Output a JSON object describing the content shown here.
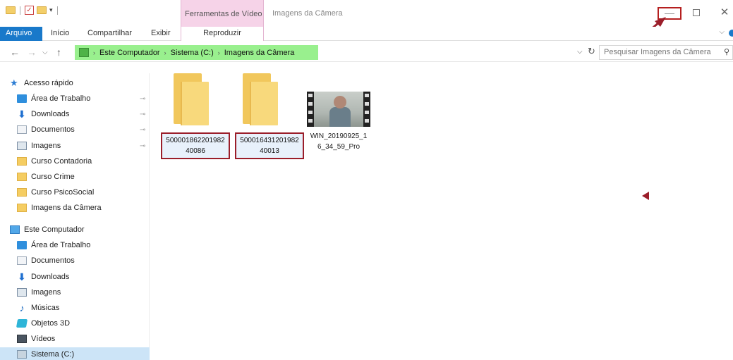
{
  "titlebar": {
    "contextual_tab": "Ferramentas de Vídeo",
    "window_title": "Imagens da Câmera",
    "qat_check": "✓",
    "qat_dropdown": "▾",
    "min_glyph": "",
    "max_glyph": "",
    "close_glyph": "✕"
  },
  "ribbon": {
    "tabs": {
      "file": "Arquivo",
      "inicio": "Início",
      "compartilhar": "Compartilhar",
      "exibir": "Exibir",
      "reproduzir": "Reproduzir"
    },
    "chevron": "⌵"
  },
  "nav": {
    "back": "←",
    "forward": "→",
    "recent": "⌵",
    "up": "↑"
  },
  "address": {
    "sep": "›",
    "crumbs": [
      "Este Computador",
      "Sistema (C:)",
      "Imagens da Câmera"
    ],
    "dropdown": "⌵",
    "refresh": "↻"
  },
  "search": {
    "placeholder": "Pesquisar Imagens da Câmera",
    "icon": "⚲"
  },
  "sidebar": {
    "items": [
      {
        "label": "Acesso rápido",
        "icon": "star-icon",
        "pinned": false
      },
      {
        "label": "Área de Trabalho",
        "icon": "desktop-icon",
        "pinned": true
      },
      {
        "label": "Downloads",
        "icon": "download-icon",
        "pinned": true
      },
      {
        "label": "Documentos",
        "icon": "document-icon",
        "pinned": true
      },
      {
        "label": "Imagens",
        "icon": "pictures-icon",
        "pinned": true
      },
      {
        "label": "Curso Contadoria",
        "icon": "folder-icon",
        "pinned": false
      },
      {
        "label": "Curso Crime",
        "icon": "folder-icon",
        "pinned": false
      },
      {
        "label": "Curso PsicoSocial",
        "icon": "folder-icon",
        "pinned": false
      },
      {
        "label": "Imagens da Câmera",
        "icon": "folder-icon",
        "pinned": false
      },
      {
        "label": "Este Computador",
        "icon": "computer-icon",
        "pinned": false
      },
      {
        "label": "Área de Trabalho",
        "icon": "desktop-icon",
        "pinned": false
      },
      {
        "label": "Documentos",
        "icon": "document-icon",
        "pinned": false
      },
      {
        "label": "Downloads",
        "icon": "download-icon",
        "pinned": false
      },
      {
        "label": "Imagens",
        "icon": "pictures-icon",
        "pinned": false
      },
      {
        "label": "Músicas",
        "icon": "music-icon",
        "pinned": false
      },
      {
        "label": "Objetos 3D",
        "icon": "objects-3d-icon",
        "pinned": false
      },
      {
        "label": "Vídeos",
        "icon": "videos-icon",
        "pinned": false
      },
      {
        "label": "Sistema (C:)",
        "icon": "drive-icon",
        "pinned": false,
        "selected": true
      }
    ],
    "pin_glyph": "📌",
    "star_glyph": "★",
    "download_glyph": "⬇",
    "music_glyph": "♪"
  },
  "content": {
    "folder1": {
      "line1": "500001862201982",
      "line2": "40086"
    },
    "folder2": {
      "line1": "500016431201982",
      "line2": "40013"
    },
    "video": {
      "line1": "WIN_20190925_1",
      "line2": "6_34_59_Pro"
    }
  },
  "colors": {
    "accent": "#1979ca",
    "annotation_red": "#9b1e2a",
    "address_highlight": "#99f08e",
    "context_tab": "#f6d3e8"
  }
}
